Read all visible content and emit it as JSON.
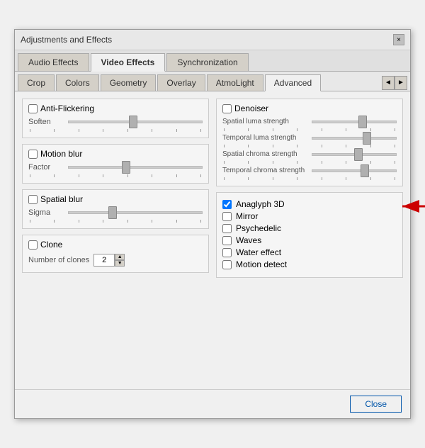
{
  "dialog": {
    "title": "Adjustments and Effects",
    "close_label": "×"
  },
  "tabs_top": {
    "items": [
      {
        "label": "Audio Effects",
        "active": false
      },
      {
        "label": "Video Effects",
        "active": true
      },
      {
        "label": "Synchronization",
        "active": false
      }
    ]
  },
  "tabs_second": {
    "items": [
      {
        "label": "Crop",
        "active": false
      },
      {
        "label": "Colors",
        "active": false
      },
      {
        "label": "Geometry",
        "active": false
      },
      {
        "label": "Overlay",
        "active": false
      },
      {
        "label": "AtmoLight",
        "active": false
      },
      {
        "label": "Advanced",
        "active": true
      }
    ],
    "nav_prev": "◄",
    "nav_next": "►"
  },
  "left_panel": {
    "anti_flickering": {
      "label": "Anti-Flickering",
      "checked": false
    },
    "soften": {
      "label": "Soften",
      "thumb_pos": "45%"
    },
    "motion_blur": {
      "label": "Motion blur",
      "checked": false
    },
    "factor": {
      "label": "Factor",
      "thumb_pos": "40%"
    },
    "spatial_blur": {
      "label": "Spatial blur",
      "checked": false
    },
    "sigma": {
      "label": "Sigma",
      "thumb_pos": "30%"
    },
    "clone": {
      "label": "Clone",
      "checked": false
    },
    "number_of_clones_label": "Number of clones",
    "number_of_clones_value": "2"
  },
  "right_panel": {
    "denoiser": {
      "label": "Denoiser",
      "checked": false
    },
    "spatial_luma": {
      "label": "Spatial luma strength",
      "thumb_pos": "55%"
    },
    "temporal_luma": {
      "label": "Temporal luma strength",
      "thumb_pos": "60%"
    },
    "spatial_chroma": {
      "label": "Spatial chroma strength",
      "thumb_pos": "50%"
    },
    "temporal_chroma": {
      "label": "Temporal chroma strength",
      "thumb_pos": "58%"
    },
    "anaglyph_3d": {
      "label": "Anaglyph 3D",
      "checked": true
    },
    "mirror": {
      "label": "Mirror",
      "checked": false
    },
    "psychedelic": {
      "label": "Psychedelic",
      "checked": false
    },
    "waves": {
      "label": "Waves",
      "checked": false
    },
    "water_effect": {
      "label": "Water effect",
      "checked": false
    },
    "motion_detect": {
      "label": "Motion detect",
      "checked": false
    }
  },
  "footer": {
    "close_label": "Close"
  }
}
